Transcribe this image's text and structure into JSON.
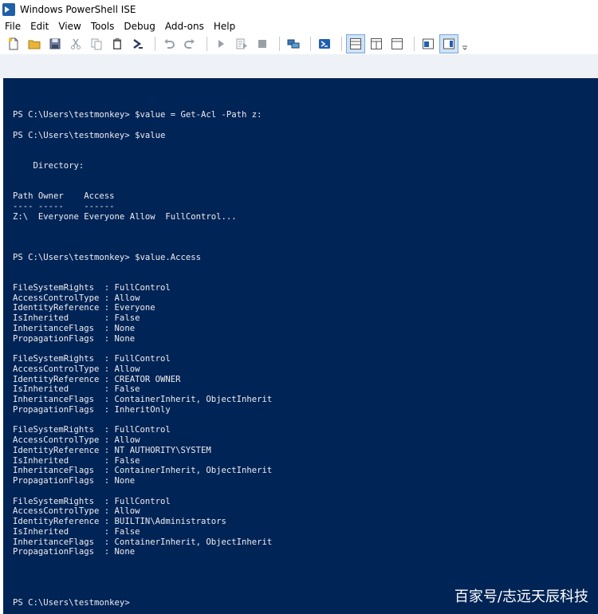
{
  "window": {
    "title": "Windows PowerShell ISE"
  },
  "menubar": {
    "items": [
      "File",
      "Edit",
      "View",
      "Tools",
      "Debug",
      "Add-ons",
      "Help"
    ]
  },
  "toolbar": {
    "buttons": [
      {
        "icon": "new-file-icon"
      },
      {
        "icon": "open-folder-icon"
      },
      {
        "icon": "save-icon"
      },
      {
        "icon": "cut-icon"
      },
      {
        "icon": "copy-icon"
      },
      {
        "icon": "paste-icon"
      },
      {
        "icon": "powershell-icon"
      },
      {
        "icon": "undo-icon"
      },
      {
        "icon": "redo-icon"
      },
      {
        "icon": "run-icon"
      },
      {
        "icon": "run-selection-icon"
      },
      {
        "icon": "stop-icon"
      },
      {
        "icon": "remote-powershell-icon"
      },
      {
        "icon": "start-powershell-icon"
      },
      {
        "icon": "show-script-pane-top-icon"
      },
      {
        "icon": "show-script-pane-right-icon"
      },
      {
        "icon": "show-script-pane-maximized-icon"
      },
      {
        "icon": "show-script-pane-icon"
      },
      {
        "icon": "show-commands-icon"
      },
      {
        "icon": "overflow-icon"
      }
    ]
  },
  "console": {
    "lines": [
      "PS C:\\Users\\testmonkey> $value = Get-Acl -Path z:",
      "",
      "PS C:\\Users\\testmonkey> $value",
      "",
      "",
      "    Directory:",
      "",
      "",
      "Path Owner    Access",
      "---- -----    ------",
      "Z:\\  Everyone Everyone Allow  FullControl...",
      "",
      "",
      "",
      "PS C:\\Users\\testmonkey> $value.Access",
      "",
      "",
      "FileSystemRights  : FullControl",
      "AccessControlType : Allow",
      "IdentityReference : Everyone",
      "IsInherited       : False",
      "InheritanceFlags  : None",
      "PropagationFlags  : None",
      "",
      "FileSystemRights  : FullControl",
      "AccessControlType : Allow",
      "IdentityReference : CREATOR OWNER",
      "IsInherited       : False",
      "InheritanceFlags  : ContainerInherit, ObjectInherit",
      "PropagationFlags  : InheritOnly",
      "",
      "FileSystemRights  : FullControl",
      "AccessControlType : Allow",
      "IdentityReference : NT AUTHORITY\\SYSTEM",
      "IsInherited       : False",
      "InheritanceFlags  : ContainerInherit, ObjectInherit",
      "PropagationFlags  : None",
      "",
      "FileSystemRights  : FullControl",
      "AccessControlType : Allow",
      "IdentityReference : BUILTIN\\Administrators",
      "IsInherited       : False",
      "InheritanceFlags  : ContainerInherit, ObjectInherit",
      "PropagationFlags  : None",
      "",
      "",
      "",
      "",
      "PS C:\\Users\\testmonkey>"
    ]
  },
  "watermark": "百家号/志远天辰科技",
  "colors": {
    "console_bg": "#012456",
    "console_text": "#eeedf0",
    "window_bg": "#ffffff",
    "accent": "#1f5ea8"
  }
}
